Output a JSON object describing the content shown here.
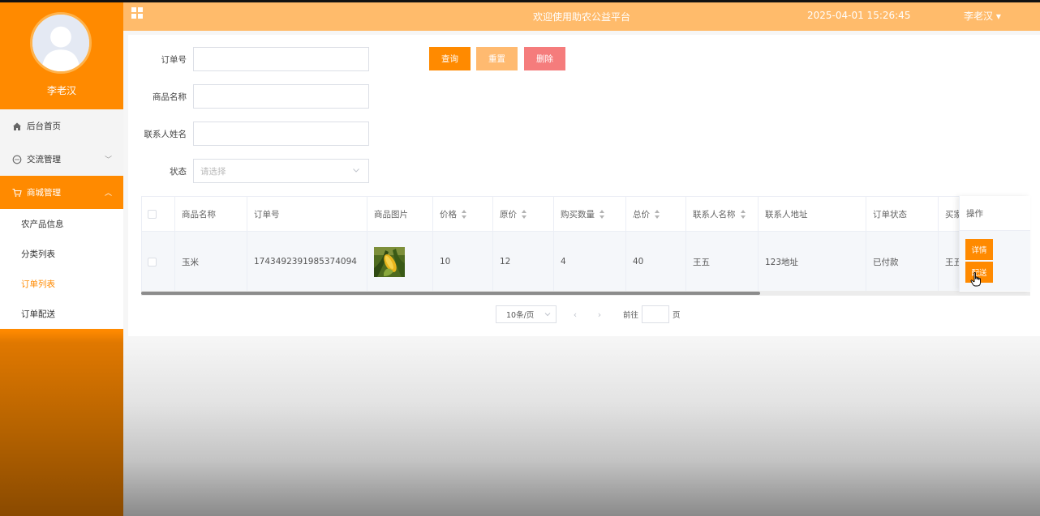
{
  "app": {
    "header_title": "欢迎使用助农公益平台",
    "datetime": "2025-04-01 15:26:45",
    "user_menu": "李老汉 ▾"
  },
  "sidebar": {
    "username": "李老汉",
    "items": [
      {
        "label": "后台首页",
        "icon": "home-icon"
      },
      {
        "label": "交流管理",
        "icon": "chat-icon",
        "chevron": "﹀"
      },
      {
        "label": "商城管理",
        "icon": "cart-icon",
        "chevron": "︿",
        "active": true
      }
    ],
    "subitems": [
      {
        "label": "农产品信息"
      },
      {
        "label": "分类列表"
      },
      {
        "label": "订单列表",
        "current": true
      },
      {
        "label": "订单配送"
      }
    ]
  },
  "search": {
    "order_no_label": "订单号",
    "product_name_label": "商品名称",
    "contact_name_label": "联系人姓名",
    "status_label": "状态",
    "status_placeholder": "请选择",
    "query_btn": "查询",
    "reset_btn": "重置",
    "delete_btn": "删除"
  },
  "table": {
    "headers": [
      "商品名称",
      "订单号",
      "商品图片",
      "价格",
      "原价",
      "购买数量",
      "总价",
      "联系人名称",
      "联系人地址",
      "订单状态",
      "买家"
    ],
    "op_header": "操作",
    "rows": [
      {
        "product_name": "玉米",
        "order_no": "1743492391985374094",
        "price": "10",
        "original_price": "12",
        "quantity": "4",
        "total": "40",
        "contact_name": "王五",
        "contact_address": "123地址",
        "status": "已付款",
        "buyer": "王五",
        "detail_btn": "详情",
        "deliver_btn": "配送"
      }
    ]
  },
  "pagination": {
    "page_size": "10条/页",
    "goto_label": "前往",
    "page_suffix": "页"
  },
  "colors": {
    "accent": "#ff8a00",
    "header_bg": "#ffbb6b",
    "reset": "#ffba70",
    "delete": "#f57c7c"
  }
}
